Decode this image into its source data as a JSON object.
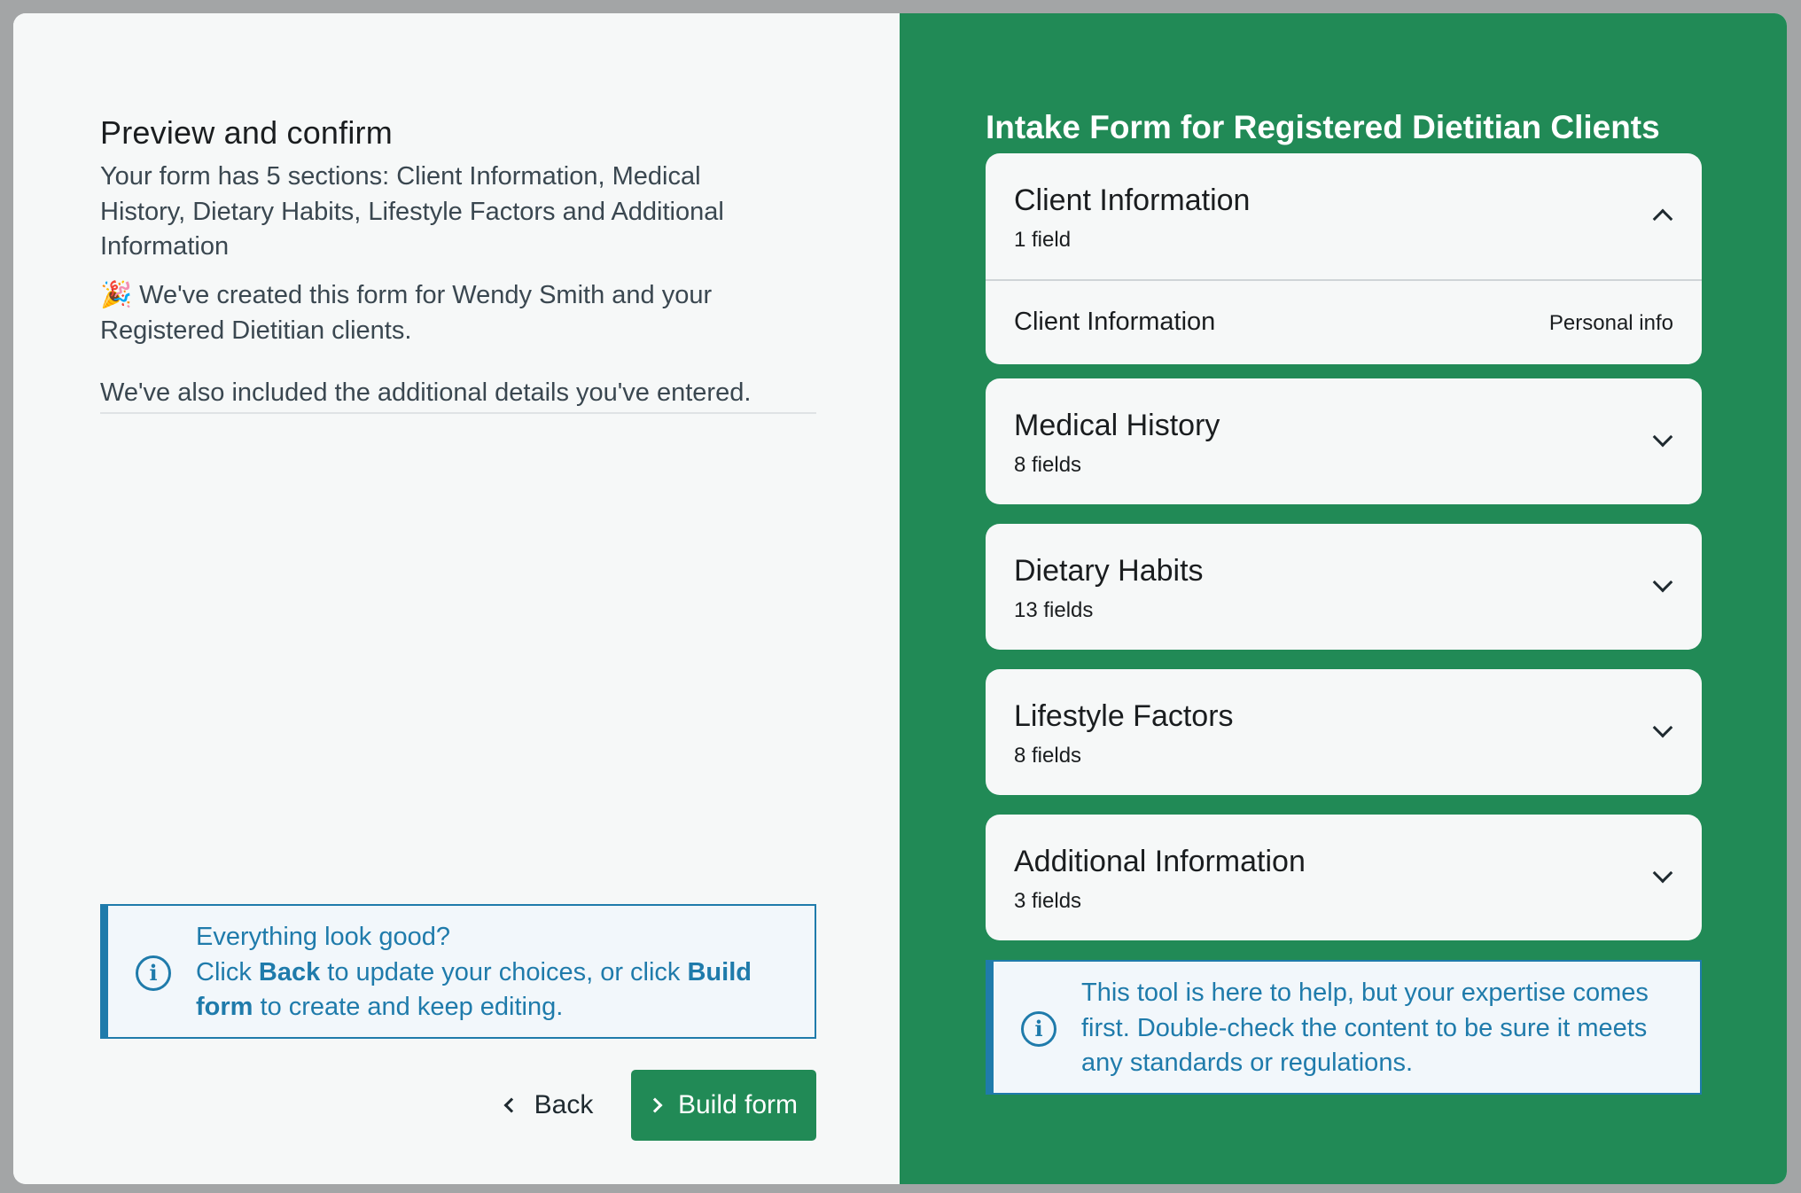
{
  "left": {
    "title": "Preview and confirm",
    "summary": "Your form has 5 sections: Client Information, Medical History, Dietary Habits, Lifestyle Factors and Additional Information",
    "created_emoji": "🎉",
    "created_text": " We've created this form for Wendy Smith and your Registered Dietitian clients.",
    "additional_text": "We've also included the additional details you've entered.",
    "info": {
      "line1": "Everything look good?",
      "click": "Click ",
      "back_bold": "Back",
      "mid": " to update your choices, or click ",
      "build_bold": "Build form",
      "end": " to create and keep editing."
    },
    "back_label": "Back",
    "build_label": "Build form"
  },
  "right": {
    "form_title": "Intake Form for Registered Dietitian Clients",
    "sections": [
      {
        "title": "Client Information",
        "count": "1 field",
        "expanded": true,
        "rows": [
          {
            "label": "Client Information",
            "tag": "Personal info"
          }
        ]
      },
      {
        "title": "Medical History",
        "count": "8 fields",
        "expanded": false
      },
      {
        "title": "Dietary Habits",
        "count": "13 fields",
        "expanded": false
      },
      {
        "title": "Lifestyle Factors",
        "count": "8 fields",
        "expanded": false
      },
      {
        "title": "Additional Information",
        "count": "3 fields",
        "expanded": false
      }
    ],
    "note": "This tool is here to help, but your expertise comes first. Double-check the content to be sure it meets any standards or regulations."
  },
  "icons": {
    "info": "i",
    "info_name": "info-icon",
    "chevron_up": "chevron-up-icon",
    "chevron_down": "chevron-down-icon",
    "chevron_left": "chevron-left-icon",
    "chevron_right": "chevron-right-icon"
  },
  "colors": {
    "brand_green": "#218a56",
    "info_blue": "#1f7bab",
    "panel_bg": "#f6f8f8"
  }
}
